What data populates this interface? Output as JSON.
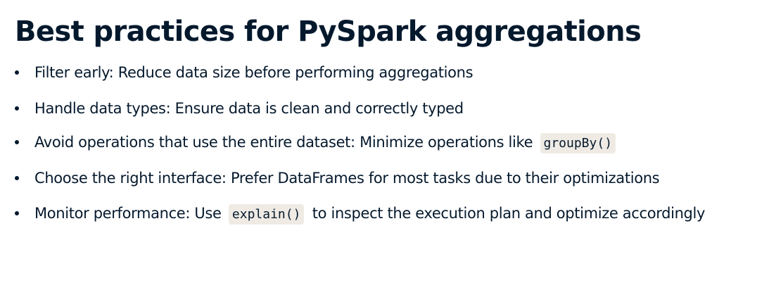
{
  "title": "Best practices for PySpark aggregations",
  "bullets": [
    {
      "text": "Filter early: Reduce data size before performing aggregations"
    },
    {
      "text": "Handle data types: Ensure data is clean and correctly typed"
    },
    {
      "before": "Avoid operations that use the entire dataset: Minimize operations like",
      "code": "groupBy()",
      "after": ""
    },
    {
      "text": "Choose the right interface: Prefer DataFrames for most tasks due to their optimizations"
    },
    {
      "before": "Monitor performance: Use",
      "code": "explain()",
      "after": "to inspect the execution plan and optimize accordingly"
    }
  ],
  "colors": {
    "text": "#05192d",
    "code_background": "#efebe4",
    "background": "#ffffff"
  }
}
